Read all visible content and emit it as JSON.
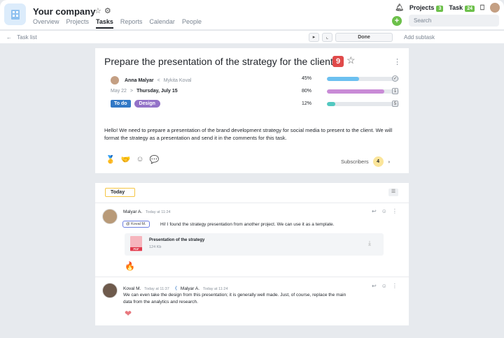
{
  "header": {
    "company": "Your company",
    "nav": [
      "Overview",
      "Projects",
      "Tasks",
      "Reports",
      "Calendar",
      "People"
    ],
    "active_nav": "Tasks",
    "projects_label": "Projects",
    "projects_count": "3",
    "task_label": "Task",
    "task_count": "24",
    "search_placeholder": "Search"
  },
  "toolbar": {
    "back_label": "Task list",
    "done_label": "Done",
    "add_subtask_label": "Add subtask"
  },
  "task": {
    "title": "Prepare the presentation of the strategy for the client",
    "number": "9",
    "assignee": "Anna Malyar",
    "author": "Mykita Koval",
    "start_date": "May 22",
    "due_date": "Thursday, July 15",
    "status_chip": "To do",
    "tag_chip": "Design",
    "progress": [
      {
        "label": "45%",
        "value": 0.45,
        "color": "#6cc0f0",
        "icon": "✓"
      },
      {
        "label": "80%",
        "value": 0.8,
        "color": "#c98bd6",
        "icon": "1"
      },
      {
        "label": "12%",
        "value": 0.12,
        "color": "#52c8c0",
        "icon": "5"
      }
    ],
    "description": "Hello! We need to prepare a presentation of the brand development strategy for social media to present to the client. We will format the strategy as a presentation and send it in the comments for this task.",
    "reactions": [
      "🥇",
      "🤝",
      "☺",
      "💬"
    ],
    "subscribers_label": "Subscribers",
    "subscribers_count": "4"
  },
  "comments": {
    "filter_label": "Today",
    "items": [
      {
        "author": "Malyar A.",
        "time": "Today at 11:24",
        "mention": "Koval M.",
        "text": "Hi! I found the strategy presentation from another project. We can use it as a template.",
        "file_name": "Presentation of the strategy",
        "file_size": "124 Kb",
        "file_type": "PDF",
        "reaction": "🔥"
      },
      {
        "author": "Koval M.",
        "time": "Today at 11:37",
        "reply_to": "Malyar A.",
        "reply_time": "Today at 11:24",
        "text": "We can even take the design from this presentation; it is generally well made. Just, of course, replace the main data from the analytics and research.",
        "reaction": "❤"
      }
    ]
  }
}
